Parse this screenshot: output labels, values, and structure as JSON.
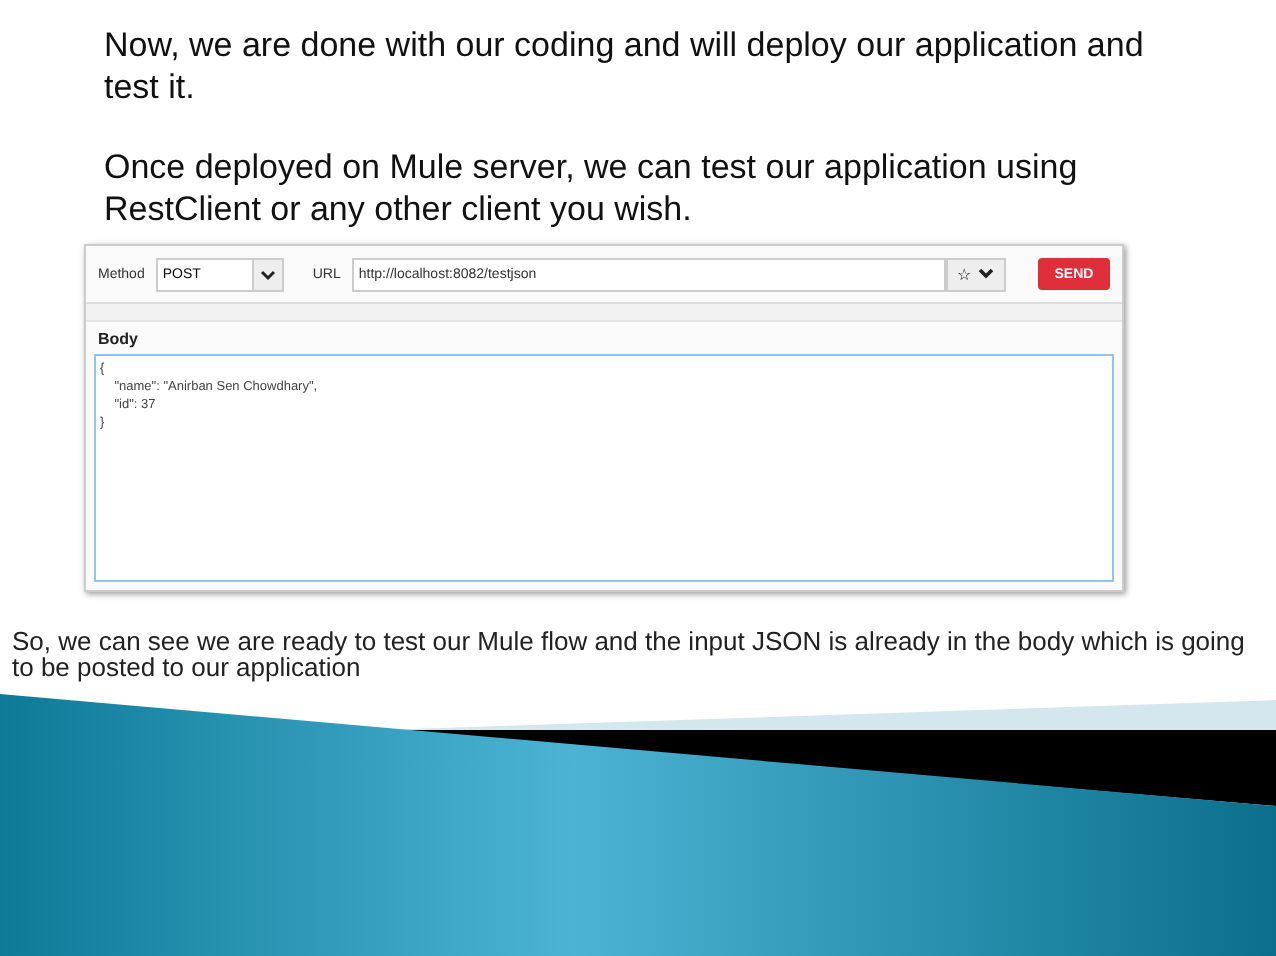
{
  "intro": [
    "Now, we are done with our coding and will deploy our application and test it.",
    "Once deployed on Mule server, we can test our application using RestClient or any other client you wish."
  ],
  "request": {
    "method_label": "Method",
    "method": "POST",
    "url_label": "URL",
    "url": "http://localhost:8082/testjson",
    "star": "☆",
    "send": "SEND"
  },
  "body": {
    "title": "Body",
    "lines": [
      "{",
      "    \"name\": \"Anirban Sen Chowdhary\",",
      "    \"id\": 37",
      "}"
    ]
  },
  "caption": "So, we can see we are ready to test our Mule flow and the input JSON is already in the body which is going to be posted to our application"
}
